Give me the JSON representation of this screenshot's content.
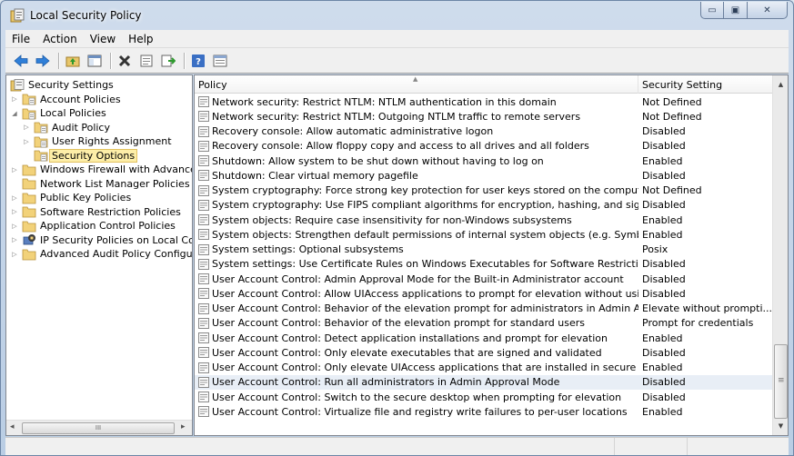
{
  "window": {
    "title": "Local Security Policy",
    "min_glyph": "▭",
    "max_glyph": "▣",
    "close_glyph": "✕"
  },
  "menu": [
    "File",
    "Action",
    "View",
    "Help"
  ],
  "toolbar": {
    "icons": [
      "back-arrow-icon",
      "forward-arrow-icon",
      "up-folder-icon",
      "show-hide-tree-icon",
      "delete-icon",
      "properties-icon",
      "export-list-icon",
      "help-icon",
      "details-view-icon"
    ]
  },
  "tree": {
    "items": [
      {
        "label": "Security Settings",
        "level": 0,
        "arrow": "",
        "icon": "security-settings-icon"
      },
      {
        "label": "Account Policies",
        "level": 1,
        "arrow": "▷",
        "icon": "policy-folder-icon"
      },
      {
        "label": "Local Policies",
        "level": 1,
        "arrow": "◢",
        "icon": "policy-folder-icon"
      },
      {
        "label": "Audit Policy",
        "level": 2,
        "arrow": "▷",
        "icon": "policy-folder-icon"
      },
      {
        "label": "User Rights Assignment",
        "level": 2,
        "arrow": "▷",
        "icon": "policy-folder-icon"
      },
      {
        "label": "Security Options",
        "level": 2,
        "arrow": "",
        "icon": "policy-folder-icon",
        "selected": true
      },
      {
        "label": "Windows Firewall with Advanced",
        "level": 1,
        "arrow": "▷",
        "icon": "folder-icon"
      },
      {
        "label": "Network List Manager Policies",
        "level": 1,
        "arrow": "",
        "icon": "folder-icon"
      },
      {
        "label": "Public Key Policies",
        "level": 1,
        "arrow": "▷",
        "icon": "folder-icon"
      },
      {
        "label": "Software Restriction Policies",
        "level": 1,
        "arrow": "▷",
        "icon": "folder-icon"
      },
      {
        "label": "Application Control Policies",
        "level": 1,
        "arrow": "▷",
        "icon": "folder-icon"
      },
      {
        "label": "IP Security Policies on Local Corr",
        "level": 1,
        "arrow": "▷",
        "icon": "ip-security-icon"
      },
      {
        "label": "Advanced Audit Policy Configura",
        "level": 1,
        "arrow": "▷",
        "icon": "folder-icon"
      }
    ],
    "hscroll_left": "◂",
    "hscroll_right": "▸",
    "hscroll_grip": "III"
  },
  "list": {
    "columns": {
      "policy": "Policy",
      "setting": "Security Setting"
    },
    "sort_caret": "▲",
    "rows": [
      {
        "policy": "Network security: Restrict NTLM: NTLM authentication in this domain",
        "setting": "Not Defined"
      },
      {
        "policy": "Network security: Restrict NTLM: Outgoing NTLM traffic to remote servers",
        "setting": "Not Defined"
      },
      {
        "policy": "Recovery console: Allow automatic administrative logon",
        "setting": "Disabled"
      },
      {
        "policy": "Recovery console: Allow floppy copy and access to all drives and all folders",
        "setting": "Disabled"
      },
      {
        "policy": "Shutdown: Allow system to be shut down without having to log on",
        "setting": "Enabled"
      },
      {
        "policy": "Shutdown: Clear virtual memory pagefile",
        "setting": "Disabled"
      },
      {
        "policy": "System cryptography: Force strong key protection for user keys stored on the computer",
        "setting": "Not Defined"
      },
      {
        "policy": "System cryptography: Use FIPS compliant algorithms for encryption, hashing, and signing",
        "setting": "Disabled"
      },
      {
        "policy": "System objects: Require case insensitivity for non-Windows subsystems",
        "setting": "Enabled"
      },
      {
        "policy": "System objects: Strengthen default permissions of internal system objects (e.g. Symbolic Links)",
        "setting": "Enabled"
      },
      {
        "policy": "System settings: Optional subsystems",
        "setting": "Posix"
      },
      {
        "policy": "System settings: Use Certificate Rules on Windows Executables for Software Restriction Policies",
        "setting": "Disabled"
      },
      {
        "policy": "User Account Control: Admin Approval Mode for the Built-in Administrator account",
        "setting": "Disabled"
      },
      {
        "policy": "User Account Control: Allow UIAccess applications to prompt for elevation without using the secur...",
        "setting": "Disabled"
      },
      {
        "policy": "User Account Control: Behavior of the elevation prompt for administrators in Admin Approval Mode",
        "setting": "Elevate without prompti..."
      },
      {
        "policy": "User Account Control: Behavior of the elevation prompt for standard users",
        "setting": "Prompt for credentials"
      },
      {
        "policy": "User Account Control: Detect application installations and prompt for elevation",
        "setting": "Enabled"
      },
      {
        "policy": "User Account Control: Only elevate executables that are signed and validated",
        "setting": "Disabled"
      },
      {
        "policy": "User Account Control: Only elevate UIAccess applications that are installed in secure locations",
        "setting": "Enabled"
      },
      {
        "policy": "User Account Control: Run all administrators in Admin Approval Mode",
        "setting": "Disabled",
        "highlight": true
      },
      {
        "policy": "User Account Control: Switch to the secure desktop when prompting for elevation",
        "setting": "Disabled"
      },
      {
        "policy": "User Account Control: Virtualize file and registry write failures to per-user locations",
        "setting": "Enabled"
      }
    ],
    "vscroll_up": "▲",
    "vscroll_down": "▼",
    "vscroll_grip": "≡"
  }
}
